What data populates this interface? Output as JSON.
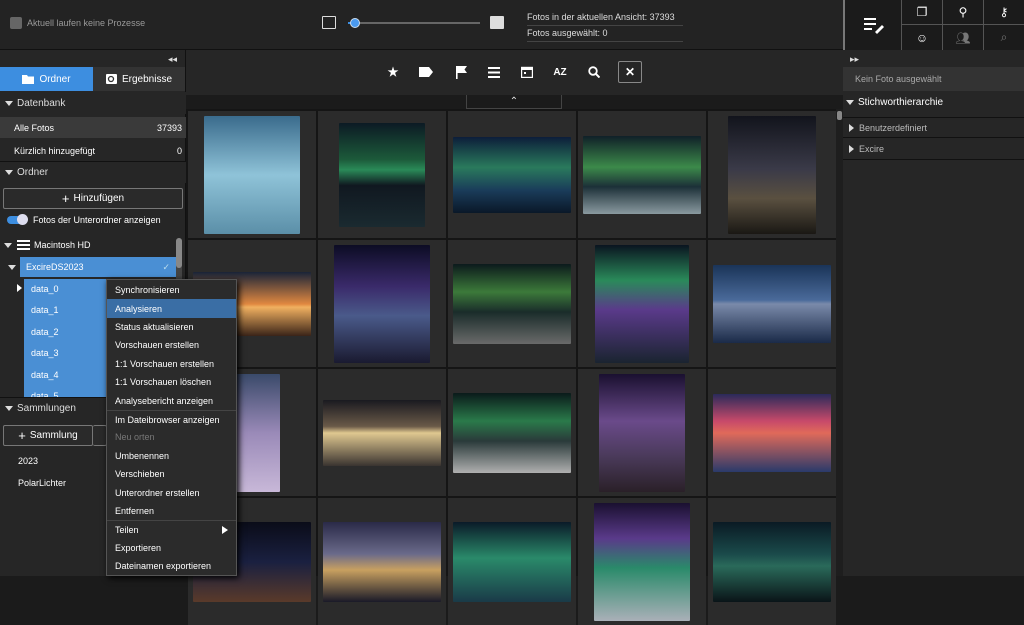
{
  "topbar": {
    "process_status": "Aktuell laufen keine Prozesse",
    "zoom": 0.05,
    "photos_in_view": "Fotos in der aktuellen Ansicht: 37393",
    "photos_selected": "Fotos ausgewählt: 0"
  },
  "left": {
    "tabs": [
      "Ordner",
      "Ergebnisse"
    ],
    "database_header": "Datenbank",
    "database_rows": [
      {
        "label": "Alle Fotos",
        "count": "37393"
      },
      {
        "label": "Kürzlich hinzugefügt",
        "count": "0"
      }
    ],
    "folders_header": "Ordner",
    "add_button": "Hinzufügen",
    "subfolder_toggle": "Fotos der Unterordner anzeigen",
    "drive": "Macintosh HD",
    "root_folder": "ExcireDS2023",
    "subfolders": [
      "data_0",
      "data_1",
      "data_2",
      "data_3",
      "data_4",
      "data_5"
    ],
    "collections_header": "Sammlungen",
    "collection_button": "Sammlung",
    "collections": [
      "2023",
      "PolarLichter"
    ]
  },
  "context_menu": [
    {
      "label": "Synchronisieren",
      "enabled": true
    },
    {
      "label": "Analysieren",
      "enabled": true,
      "highlighted": true
    },
    {
      "label": "Status aktualisieren",
      "enabled": true
    },
    {
      "label": "Vorschauen erstellen",
      "enabled": true
    },
    {
      "label": "1:1 Vorschauen erstellen",
      "enabled": true
    },
    {
      "label": "1:1 Vorschauen löschen",
      "enabled": true
    },
    {
      "label": "Analysebericht anzeigen",
      "enabled": true
    },
    {
      "label": "Im Dateibrowser anzeigen",
      "enabled": true
    },
    {
      "label": "Neu orten",
      "enabled": false
    },
    {
      "label": "Umbenennen",
      "enabled": true
    },
    {
      "label": "Verschieben",
      "enabled": true
    },
    {
      "label": "Unterordner erstellen",
      "enabled": true
    },
    {
      "label": "Entfernen",
      "enabled": true
    },
    {
      "label": "Teilen",
      "enabled": true,
      "submenu": true
    },
    {
      "label": "Exportieren",
      "enabled": true
    },
    {
      "label": "Dateinamen exportieren",
      "enabled": true
    }
  ],
  "toolbar_icons": [
    "star-icon",
    "tag-icon",
    "flag-icon",
    "list-icon",
    "calendar-icon",
    "sort-az-icon",
    "search-icon",
    "close-icon"
  ],
  "toolbar_sort_label": "AZ",
  "right": {
    "no_photo": "Kein Foto ausgewählt",
    "keywords_header": "Stichworthierarchie",
    "keyword_items": [
      "Benutzerdefiniert",
      "Excire"
    ]
  },
  "colors": {
    "accent": "#3d8ee0",
    "selection": "#4a8fd4",
    "menu_highlight": "#3a6ea5"
  },
  "photos": [
    {
      "name": "lone-tree-ice",
      "bg": "linear-gradient(#3a6b8c,#8fc3d8 50%,#5b8fa8)"
    },
    {
      "name": "aurora-ring",
      "bg": "linear-gradient(#0c1a24,#1c5a3a 35%,#2a8a58 45%,#101820 60%,#1a2a30)"
    },
    {
      "name": "aurora-mountain",
      "bg": "linear-gradient(#0c1e3a,#2a7a5c 40%,#1a3c5a 70%,#0a1828)"
    },
    {
      "name": "aurora-beach",
      "bg": "linear-gradient(#102028,#3c8a4a 40%,#1c3038 65%,#8a9aa0)"
    },
    {
      "name": "milkyway-cabin",
      "bg": "linear-gradient(#12141c,#3a3a48 45%,#5a5040 70%,#1a1814)"
    },
    {
      "name": "sunset-boat",
      "bg": "linear-gradient(#1a2438,#e08840 50%,#f0b060 55%,#3a2418)"
    },
    {
      "name": "milkyway-lake",
      "bg": "linear-gradient(#0c0c24,#3a2a6a 35%,#4a5a8a 60%,#1a1a30)"
    },
    {
      "name": "aurora-snow-coast",
      "bg": "linear-gradient(#0c1a1c,#3c7a3a 35%,#1a2c2a 60%,#6a6a6a)"
    },
    {
      "name": "aurora-purple",
      "bg": "linear-gradient(#0a1420,#2a8a5a 30%,#5a3a8a 55%,#1a2430)"
    },
    {
      "name": "tree-reflection",
      "bg": "linear-gradient(#1a3458,#4a6a9a 45%,#7a8aaa 50%,#1a2a48)"
    },
    {
      "name": "lighthouse-clouds",
      "bg": "linear-gradient(#3a4a6a,#9a8ab8 50%,#c8b8d8)"
    },
    {
      "name": "storm-sunburst",
      "bg": "linear-gradient(#1a1a20,#6a5a48 40%,#e0c890 50%,#3a3430)"
    },
    {
      "name": "aurora-snow-peaks",
      "bg": "linear-gradient(#0a1a1a,#2a7a4a 35%,#2a3a3a 60%,#b0b0b0)"
    },
    {
      "name": "milkyway-rock",
      "bg": "linear-gradient(#1a1030,#6a4a8a 40%,#4a3a5a 70%,#2a2028)"
    },
    {
      "name": "pink-sky-pier",
      "bg": "linear-gradient(#2a2a5a,#c84a6a 35%,#e06a5a 50%,#2a3a6a)"
    },
    {
      "name": "night-road",
      "bg": "linear-gradient(#0a0c18,#1a2040 50%,#5a3a2a)"
    },
    {
      "name": "aurora-wave",
      "bg": "linear-gradient(#2a2a48,#6a6a8a 40%,#c8a060 60%,#1a1a28)"
    },
    {
      "name": "aurora-lake",
      "bg": "linear-gradient(#0a1a28,#2a8a6a 45%,#1a3a48)"
    },
    {
      "name": "aurora-houses",
      "bg": "linear-gradient(#1a1030,#5a3a8a 30%,#2a8a6a 55%,#aab0b8)"
    },
    {
      "name": "aurora-forest",
      "bg": "linear-gradient(#0a1a24,#1a4a4a 40%,#2a6a5a 55%,#0a1418)"
    }
  ]
}
